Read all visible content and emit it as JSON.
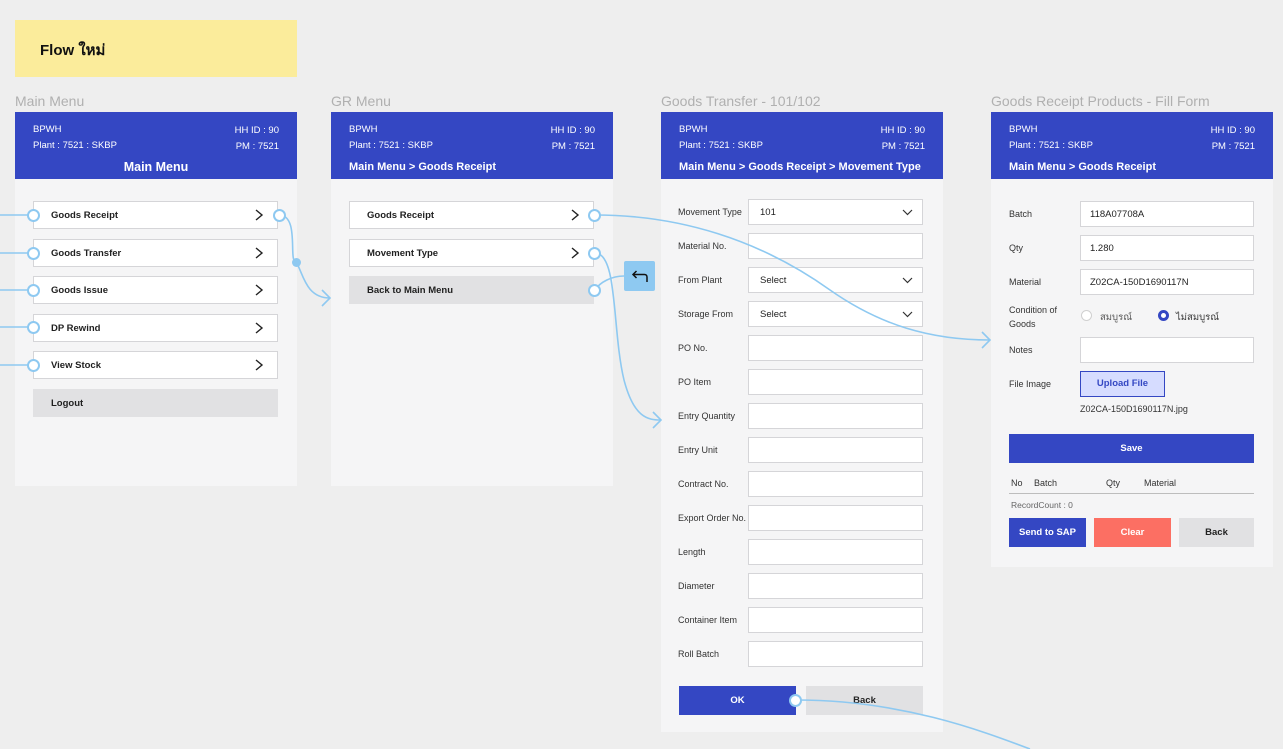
{
  "note_label": "Flow ใหม่",
  "colors": {
    "primary": "#3447c3",
    "danger": "#fc6f63",
    "connector": "#8ec9f1",
    "sticky": "#fbec9b"
  },
  "header": {
    "company": "BPWH",
    "plant": "Plant : 7521 : SKBP",
    "hh_id": "HH ID : 90",
    "pm": "PM : 7521"
  },
  "screens": {
    "main_menu": {
      "frame_title": "Main Menu",
      "title": "Main Menu",
      "items": [
        "Goods Receipt",
        "Goods Transfer",
        "Goods Issue",
        "DP Rewind",
        "View Stock"
      ],
      "logout": "Logout"
    },
    "gr_menu": {
      "frame_title": "GR Menu",
      "breadcrumb": "Main Menu > Goods Receipt",
      "items": [
        "Goods Receipt",
        "Movement Type"
      ],
      "back": "Back to Main Menu"
    },
    "goods_transfer": {
      "frame_title": "Goods Transfer - 101/102",
      "breadcrumb": "Main Menu > Goods Receipt > Movement Type",
      "movement_type": {
        "label": "Movement Type",
        "value": "101"
      },
      "material_no": {
        "label": "Material No.",
        "value": ""
      },
      "from_plant": {
        "label": "From Plant",
        "value": "Select"
      },
      "storage_from": {
        "label": "Storage From",
        "value": "Select"
      },
      "fields": [
        "PO No.",
        "PO Item",
        "Entry Quantity",
        "Entry Unit",
        "Contract No.",
        "Export Order No.",
        "Length",
        "Diameter",
        "Container Item",
        "Roll Batch"
      ],
      "ok": "OK",
      "back": "Back"
    },
    "fill_form": {
      "frame_title": "Goods Receipt Products - Fill Form",
      "breadcrumb": "Main Menu > Goods Receipt",
      "batch": {
        "label": "Batch",
        "value": "118A07708A"
      },
      "qty": {
        "label": "Qty",
        "value": "1.280"
      },
      "material": {
        "label": "Material",
        "value": "Z02CA-150D1690117N"
      },
      "condition": {
        "label_1": "Condition of",
        "label_2": "Goods",
        "opt_complete": "สมบูรณ์",
        "opt_incomplete": "ไม่สมบูรณ์",
        "selected": "ไม่สมบูรณ์"
      },
      "notes": {
        "label": "Notes",
        "value": ""
      },
      "file_image": {
        "label": "File Image",
        "button": "Upload File",
        "filename": "Z02CA-150D1690117N.jpg"
      },
      "save": "Save",
      "table_headers": [
        "No",
        "Batch",
        "Qty",
        "Material"
      ],
      "record_count": "RecordCount : 0",
      "send_to_sap": "Send to SAP",
      "clear": "Clear",
      "back": "Back"
    }
  }
}
